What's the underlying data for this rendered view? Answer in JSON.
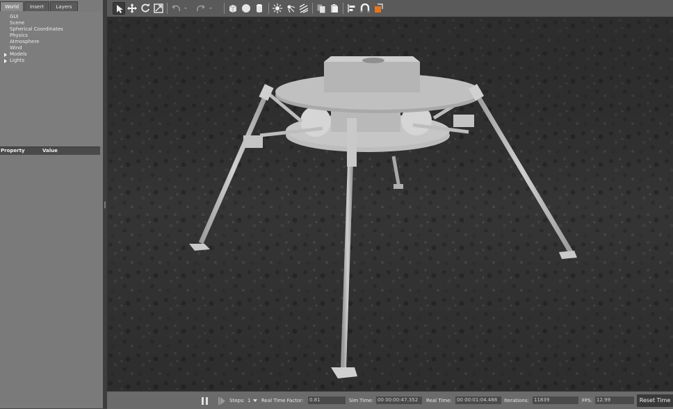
{
  "left_panel": {
    "tabs": [
      "World",
      "Insert",
      "Layers"
    ],
    "tree_items": [
      "GUI",
      "Scene",
      "Spherical Coordinates",
      "Physics",
      "Atmosphere",
      "Wind",
      "Models",
      "Lights"
    ],
    "property_header": {
      "property": "Property",
      "value": "Value"
    }
  },
  "toolbar": {
    "tools": [
      "select-arrow-icon",
      "translate-icon",
      "rotate-icon",
      "scale-icon",
      "undo-icon",
      "redo-icon",
      "box-icon",
      "sphere-icon",
      "cylinder-icon",
      "point-light-icon",
      "spot-light-icon",
      "directional-light-icon",
      "copy-icon",
      "paste-icon",
      "align-icon",
      "snap-icon",
      "change-view-icon"
    ]
  },
  "statusbar": {
    "steps_label": "Steps:",
    "steps_value": "1",
    "real_time_factor_label": "Real Time Factor:",
    "real_time_factor": "0.81",
    "sim_time_label": "Sim Time:",
    "sim_time": "00 00:00:47.352",
    "real_time_label": "Real Time:",
    "real_time": "00 00:01:04.488",
    "iterations_label": "Iterations:",
    "iterations": "11839",
    "fps_label": "FPS:",
    "fps": "12.99",
    "reset_label": "Reset Time"
  },
  "colors": {
    "accent_orange": "#e8741a",
    "ground_dark": "#2f2f2f",
    "model_grey": "#b9b9b9"
  }
}
